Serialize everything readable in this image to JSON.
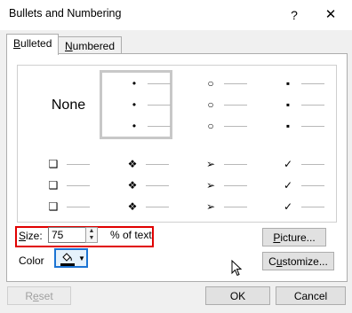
{
  "dialog": {
    "title": "Bullets and Numbering",
    "help_icon": "?",
    "close_icon": "✕"
  },
  "tabs": [
    {
      "label_u": "B",
      "label_rest": "ulleted",
      "selected": true
    },
    {
      "label_u": "N",
      "label_rest": "umbered",
      "selected": false
    }
  ],
  "gallery": {
    "none_label": "None",
    "selected_index": 1,
    "cells": [
      {
        "name": "none"
      },
      {
        "name": "filled-dot",
        "glyph": "•"
      },
      {
        "name": "hollow-circle",
        "glyph": "○"
      },
      {
        "name": "filled-square",
        "glyph": "▪"
      },
      {
        "name": "hollow-square",
        "glyph": "❑"
      },
      {
        "name": "four-diamond",
        "glyph": "❖"
      },
      {
        "name": "arrowhead",
        "glyph": "➢"
      },
      {
        "name": "checkmark",
        "glyph": "✓"
      }
    ]
  },
  "size": {
    "label_u": "S",
    "label_rest": "ize:",
    "value": "75",
    "unit": "% of text"
  },
  "color": {
    "label": "Color",
    "icon": "paint-bucket-icon",
    "current": "#000000"
  },
  "buttons": {
    "picture_u": "P",
    "picture_rest": "icture...",
    "customize_pre": "C",
    "customize_u": "u",
    "customize_rest": "stomize...",
    "reset_pre": "R",
    "reset_u": "e",
    "reset_rest": "set",
    "ok": "OK",
    "cancel": "Cancel"
  }
}
